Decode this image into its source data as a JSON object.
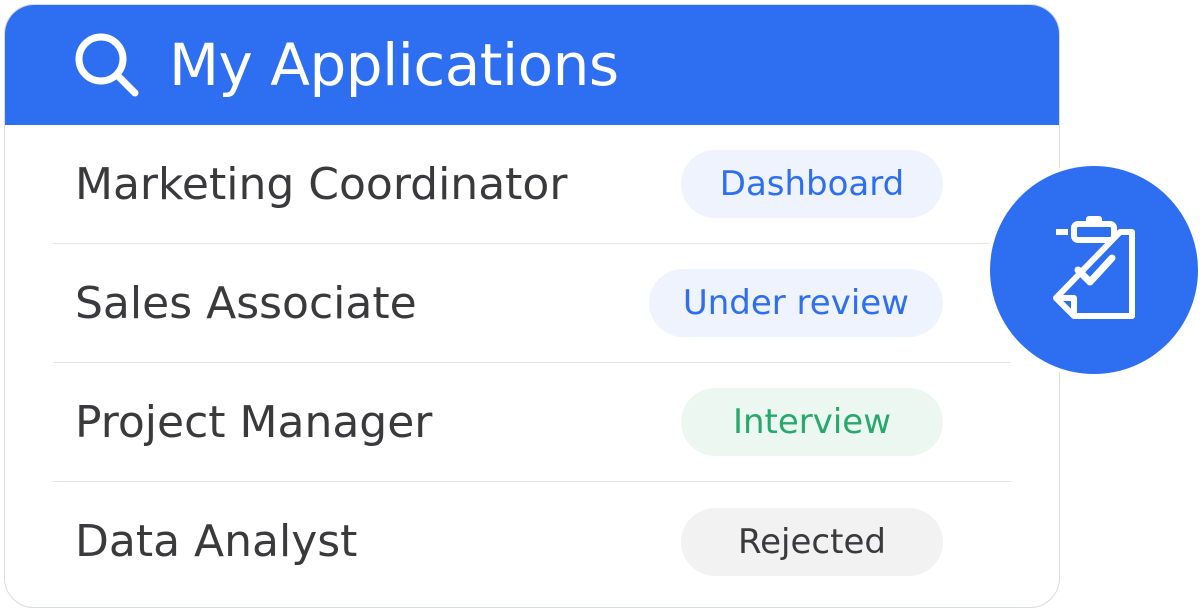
{
  "header": {
    "title": "My Applications",
    "icon": "search-icon"
  },
  "colors": {
    "accent": "#2e6ff2",
    "text": "#3a3a3d"
  },
  "applications": [
    {
      "title": "Marketing Coordinator",
      "status": "Dashboard",
      "status_color": "#2e6ff2",
      "status_bg": "#eef3fd"
    },
    {
      "title": "Sales Associate",
      "status": "Under review",
      "status_color": "#2e6ff2",
      "status_bg": "#eef3fd"
    },
    {
      "title": "Project Manager",
      "status": "Interview",
      "status_color": "#27a96c",
      "status_bg": "#ecf7f1"
    },
    {
      "title": "Data Analyst",
      "status": "Rejected",
      "status_color": "#3a3a3d",
      "status_bg": "#f2f2f3"
    }
  ],
  "fab": {
    "icon": "clipboard-check-icon"
  }
}
